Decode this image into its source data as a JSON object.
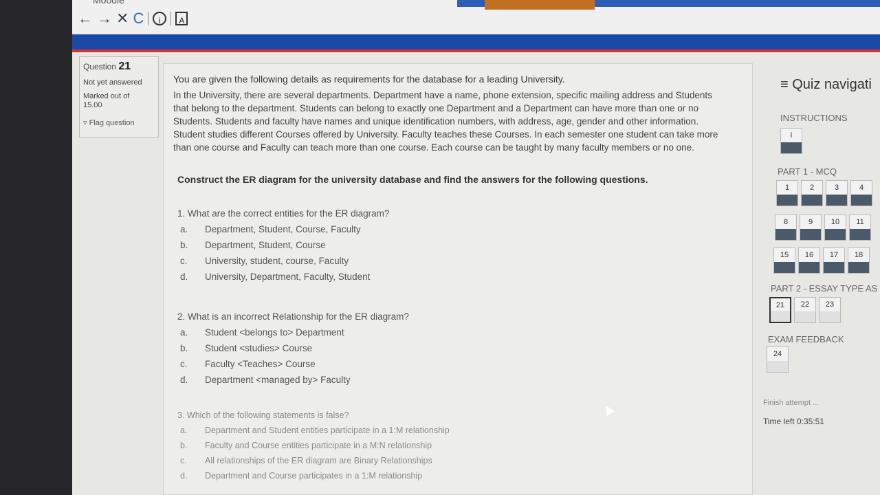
{
  "browser": {
    "brand": "Moodle",
    "nav": {
      "back": "←",
      "forward": "→",
      "stop": "✕",
      "reload": "C",
      "info": "i",
      "reader": "A"
    }
  },
  "question_info": {
    "question_prefix": "Question",
    "question_number": "21",
    "state": "Not yet answered",
    "marked_out_of": "Marked out of",
    "marked_value": "15.00",
    "flag_label": "Flag question"
  },
  "question": {
    "intro": "You are given the following details as requirements for the database for a leading University.",
    "paragraph": "In the University, there are several departments. Department have a name, phone extension, specific mailing address and Students that belong to the department. Students can belong to exactly one Department and a Department can have more than one or no Students. Students and faculty have names and unique identification numbers, with address, age, gender and other information. Student studies different Courses offered by University. Faculty teaches these Courses. In each semester one student can take more than one course and Faculty can teach more than one course. Each course can be taught by many faculty members or no one.",
    "construct": "Construct the ER diagram for the university database and find the answers for the following questions.",
    "subquestions": [
      {
        "text": "1. What are the correct entities for the ER diagram?",
        "options": [
          {
            "letter": "a.",
            "text": "Department, Student, Course, Faculty"
          },
          {
            "letter": "b.",
            "text": "Department, Student, Course"
          },
          {
            "letter": "c.",
            "text": "University, student, course, Faculty"
          },
          {
            "letter": "d.",
            "text": "University, Department, Faculty, Student"
          }
        ]
      },
      {
        "text": "2. What is an incorrect Relationship for the ER diagram?",
        "options": [
          {
            "letter": "a.",
            "text": "Student <belongs to> Department"
          },
          {
            "letter": "b.",
            "text": "Student <studies> Course"
          },
          {
            "letter": "c.",
            "text": "Faculty <Teaches> Course"
          },
          {
            "letter": "d.",
            "text": "Department <managed by> Faculty"
          }
        ]
      },
      {
        "text": "3. Which of the following statements is false?",
        "options": [
          {
            "letter": "a.",
            "text": "Department and Student entities participate in a 1:M relationship"
          },
          {
            "letter": "b.",
            "text": "Faculty and Course entities participate in a M:N relationship"
          },
          {
            "letter": "c.",
            "text": "All relationships of the ER diagram are Binary Relationships"
          },
          {
            "letter": "d.",
            "text": "Department and Course participates in a 1:M relationship"
          }
        ]
      }
    ]
  },
  "quiz_nav": {
    "title": "≡ Quiz navigati",
    "instructions_label": "INSTRUCTIONS",
    "instructions_btn": "i",
    "part1_label": "PART 1 - MCQ",
    "part1_rows": [
      [
        "1",
        "2",
        "3",
        "4"
      ],
      [
        "8",
        "9",
        "10",
        "11"
      ],
      [
        "15",
        "16",
        "17",
        "18"
      ]
    ],
    "part2_label": "PART 2 - ESSAY TYPE AS",
    "part2_buttons": [
      "21",
      "22",
      "23"
    ],
    "feedback_label": "EXAM FEEDBACK",
    "feedback_buttons": [
      "24"
    ],
    "finish": "Finish attempt ...",
    "time_left_label": "Time left",
    "time_left_value": "0:35:51"
  }
}
